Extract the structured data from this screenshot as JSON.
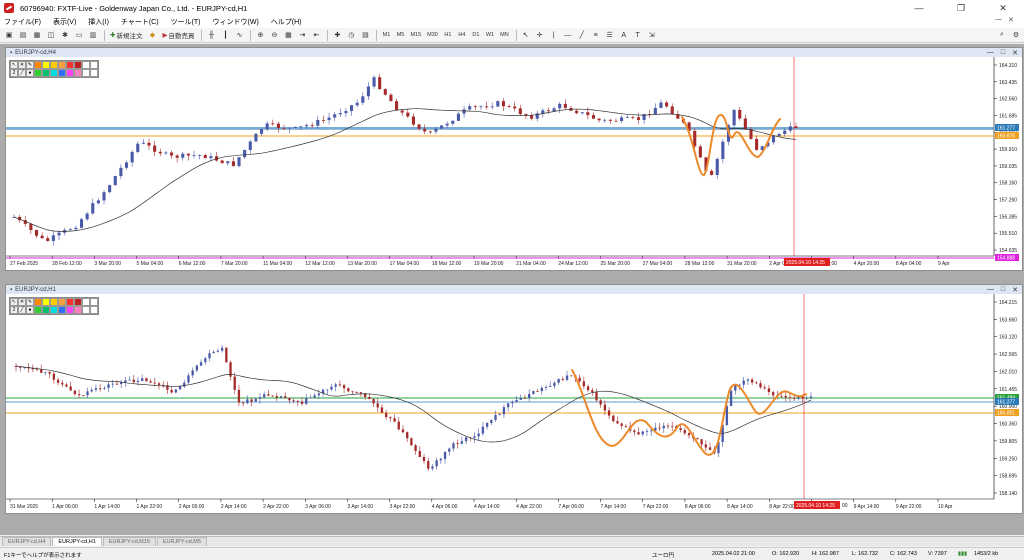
{
  "window": {
    "title": "60796940: FXTF-Live - Goldenway Japan Co., Ltd. - EURJPY-cd,H1"
  },
  "menu": [
    "ファイル(F)",
    "表示(V)",
    "挿入(I)",
    "チャート(C)",
    "ツール(T)",
    "ウィンドウ(W)",
    "ヘルプ(H)"
  ],
  "toolbar": {
    "new_order": "新規注文",
    "auto_trade": "自動売買",
    "timeframes": [
      "M1",
      "M5",
      "M15",
      "M30",
      "H1",
      "H4",
      "D1",
      "W1",
      "MN"
    ]
  },
  "chart_top": {
    "label": "EURJPY-cd,H4",
    "price_labels": [
      "164.310",
      "163.435",
      "162.560",
      "161.685",
      "160.810",
      "159.910",
      "159.035",
      "158.160",
      "157.260",
      "156.385",
      "155.510",
      "154.635"
    ],
    "highlight_labels": [
      {
        "text": "161.277",
        "color": "#2a7ab8"
      },
      {
        "text": "160.876",
        "color": "#f0a020"
      },
      {
        "text": "154.888",
        "color": "#e020e0"
      }
    ],
    "time_labels": [
      "27 Feb 2025",
      "28 Feb 12:00",
      "3 Mar 20:00",
      "5 Mar 04:00",
      "6 Mar 12:00",
      "7 Mar 20:00",
      "11 Mar 04:00",
      "12 Mar 12:00",
      "13 Mar 20:00",
      "17 Mar 04:00",
      "18 Mar 12:00",
      "19 Mar 20:00",
      "21 Mar 04:00",
      "24 Mar 12:00",
      "25 Mar 20:00",
      "27 Mar 04:00",
      "28 Mar 12:00",
      "31 Mar 20:00",
      "2 Apr 04:00",
      "3 Apr 12:00",
      "4 Apr 20:00",
      "8 Apr 04:00",
      "9 Apr"
    ],
    "cursor_time": "2025.04.10 14:25"
  },
  "chart_bottom": {
    "label": "EURJPY-cd,H1",
    "price_labels": [
      "164.215",
      "163.660",
      "163.120",
      "162.565",
      "162.010",
      "161.455",
      "160.900",
      "160.360",
      "159.805",
      "159.250",
      "158.695",
      "158.140"
    ],
    "highlight_labels": [
      {
        "text": "161.489",
        "color": "#2aa040"
      },
      {
        "text": "161.277",
        "color": "#2a7ab8"
      },
      {
        "text": "160.851",
        "color": "#f0a020"
      }
    ],
    "time_labels": [
      "31 Mar 2025",
      "1 Apr 06:00",
      "1 Apr 14:00",
      "1 Apr 22:00",
      "2 Apr 06:00",
      "2 Apr 14:00",
      "2 Apr 22:00",
      "3 Apr 06:00",
      "3 Apr 14:00",
      "3 Apr 22:00",
      "4 Apr 06:00",
      "4 Apr 14:00",
      "4 Apr 22:00",
      "7 Apr 06:00",
      "7 Apr 14:00",
      "7 Apr 22:00",
      "8 Apr 06:00",
      "8 Apr 14:00",
      "8 Apr 22:00",
      "9 Apr 06:00",
      "9 Apr 14:00",
      "9 Apr 22:00",
      "10 Apr"
    ],
    "cursor_time": "2025.04.10 14:25",
    "cursor_suffix": "00"
  },
  "tabs": [
    "EURJPY-cd,H4",
    "EURJPY-cd,H1",
    "EURJPY-cd,M15",
    "EURJPY-cd,M5"
  ],
  "active_tab": 1,
  "status": {
    "help": "F1キーでヘルプが表示されます",
    "profile": "ユーロ円",
    "datetime": "2025.04.02 21:00",
    "open": "O: 162.920",
    "high": "H: 162.987",
    "low": "L: 162.732",
    "close": "C: 162.743",
    "volume": "V: 7397",
    "traffic": "1453/2 kb"
  },
  "colors": {
    "bull": "#4a5aa8",
    "bear": "#a52a2a",
    "ma": "#333333",
    "orange": "#ec8a2c",
    "cursor": "#e02020"
  }
}
